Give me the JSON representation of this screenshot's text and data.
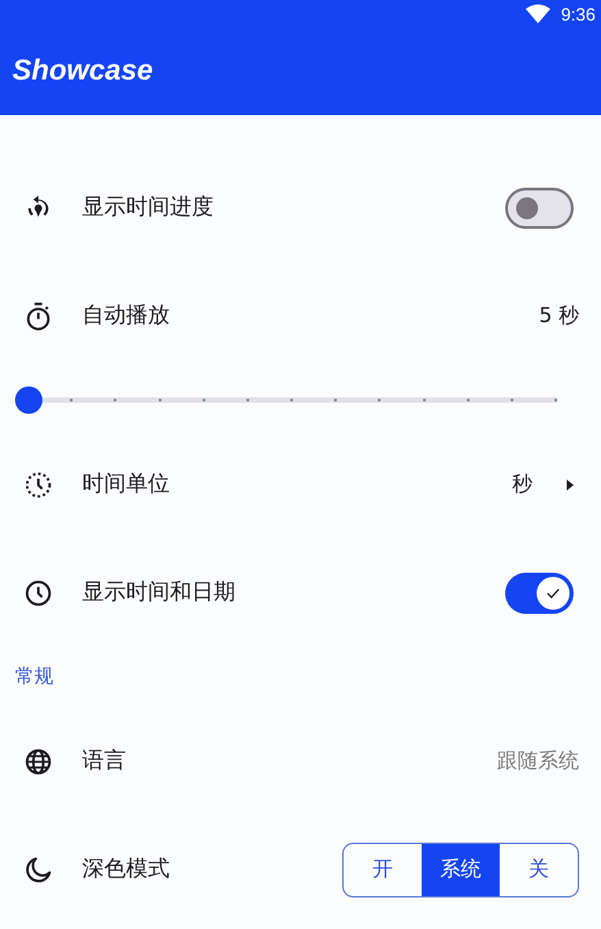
{
  "status_bar": {
    "time": "9:36"
  },
  "app_bar": {
    "title": "Showcase"
  },
  "settings": [
    {
      "kind": "switch",
      "label": "显示时间进度",
      "on": false
    },
    {
      "kind": "value",
      "label": "自动播放",
      "value": "5 秒"
    },
    {
      "kind": "slider",
      "level": 0
    },
    {
      "kind": "nav",
      "label": "时间单位",
      "value": "秒"
    },
    {
      "kind": "switch",
      "label": "显示时间和日期",
      "on": true
    },
    {
      "kind": "header",
      "label": "常规"
    },
    {
      "kind": "value",
      "label": "语言",
      "value": "跟随系统",
      "muted": true
    },
    {
      "kind": "segmented",
      "label": "深色模式",
      "options": [
        {
          "label": "开",
          "selected": false
        },
        {
          "label": "系统",
          "selected": true
        },
        {
          "label": "关",
          "selected": false
        }
      ]
    }
  ]
}
